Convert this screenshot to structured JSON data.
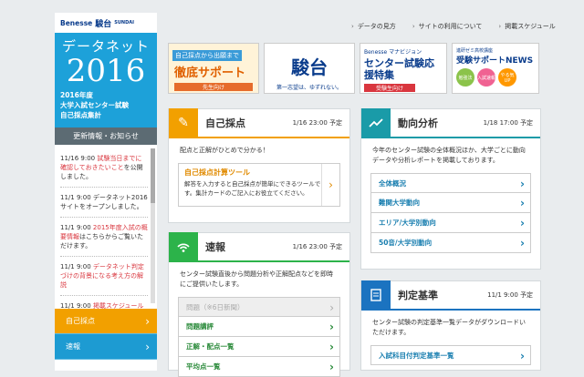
{
  "brand": {
    "benesse": "Benesse",
    "sundai": "駿台",
    "sundai_en": "SUNDAI"
  },
  "hero": {
    "title": "データネット",
    "year": "2016",
    "sub1": "2016年度",
    "sub2": "大学入試センター試験",
    "sub3": "自己採点集計"
  },
  "news": {
    "header": "更新情報・お知らせ",
    "items": [
      {
        "date": "11/16 9:00",
        "red": "試験当日までに確認しておきたいこと",
        "rest": "を公開しました。"
      },
      {
        "date": "11/1 9:00",
        "red": "",
        "rest": "データネット2016サイトをオープンしました。"
      },
      {
        "date": "11/1 9:00",
        "red": "2015年度入試の概要情報",
        "rest": "はこちらからご覧いただけます。"
      },
      {
        "date": "11/1 9:00",
        "red": "データネット判定づけの背景になる考え方の解説",
        "rest": ""
      },
      {
        "date": "11/1 9:00",
        "red": "掲載スケジュール",
        "rest": ""
      }
    ]
  },
  "menu": [
    "自己採点",
    "速報",
    "動向分析"
  ],
  "toplinks": [
    "データの見方",
    "サイトの利用について",
    "掲載スケジュール"
  ],
  "banners": {
    "b1": {
      "a": "自己採点から出願まで",
      "b": "徹底サポート",
      "c": "先生向け"
    },
    "b2": {
      "a": "駿台",
      "b": "第一志望は、ゆずれない。"
    },
    "b3": {
      "a": "Benesse マナビジョン",
      "b": "センター試験応援特集",
      "c": "受験生向け"
    },
    "b4": {
      "a": "進研ゼミ高校講座",
      "b": "受験サポートNEWS",
      "c1": "勉強法",
      "c2": "入試速報",
      "c3": "やる気UP"
    }
  },
  "cards": {
    "self": {
      "title": "自己採点",
      "date": "1/16 23:00 予定",
      "desc": "配点と正解がひとめで分かる！",
      "tool_title": "自己採点計算ツール",
      "tool_desc": "解答を入力すると自己採点が簡単にできるツールです。集計カードのご記入にお役立てください。"
    },
    "sokuho": {
      "title": "速報",
      "date": "1/16 23:00 予定",
      "desc": "センター試験直後から問題分析や正解配点などを即時にご提供いたします。",
      "links": [
        "問題（※6日新聞）",
        "問題講評",
        "正解・配点一覧",
        "平均点一覧"
      ]
    },
    "doko": {
      "title": "動向分析",
      "date": "1/18 17:00 予定",
      "desc": "今年のセンター試験の全体概況ほか、大学ごとに動向データや分析レポートを掲載しております。",
      "links": [
        "全体概況",
        "難関大学動向",
        "エリア/大学別動向",
        "50音/大学別動向"
      ]
    },
    "hantei": {
      "title": "判定基準",
      "date": "11/1 9:00 予定",
      "desc": "センター試験の判定基準一覧データがダウンロードいただけます。",
      "links": [
        "入試科目付判定基準一覧"
      ]
    }
  },
  "colors": {
    "blue": "#1da1d9",
    "orange": "#f2a000",
    "green": "#2cb34a",
    "teal": "#1a9ba8",
    "navy": "#1b73c0"
  }
}
